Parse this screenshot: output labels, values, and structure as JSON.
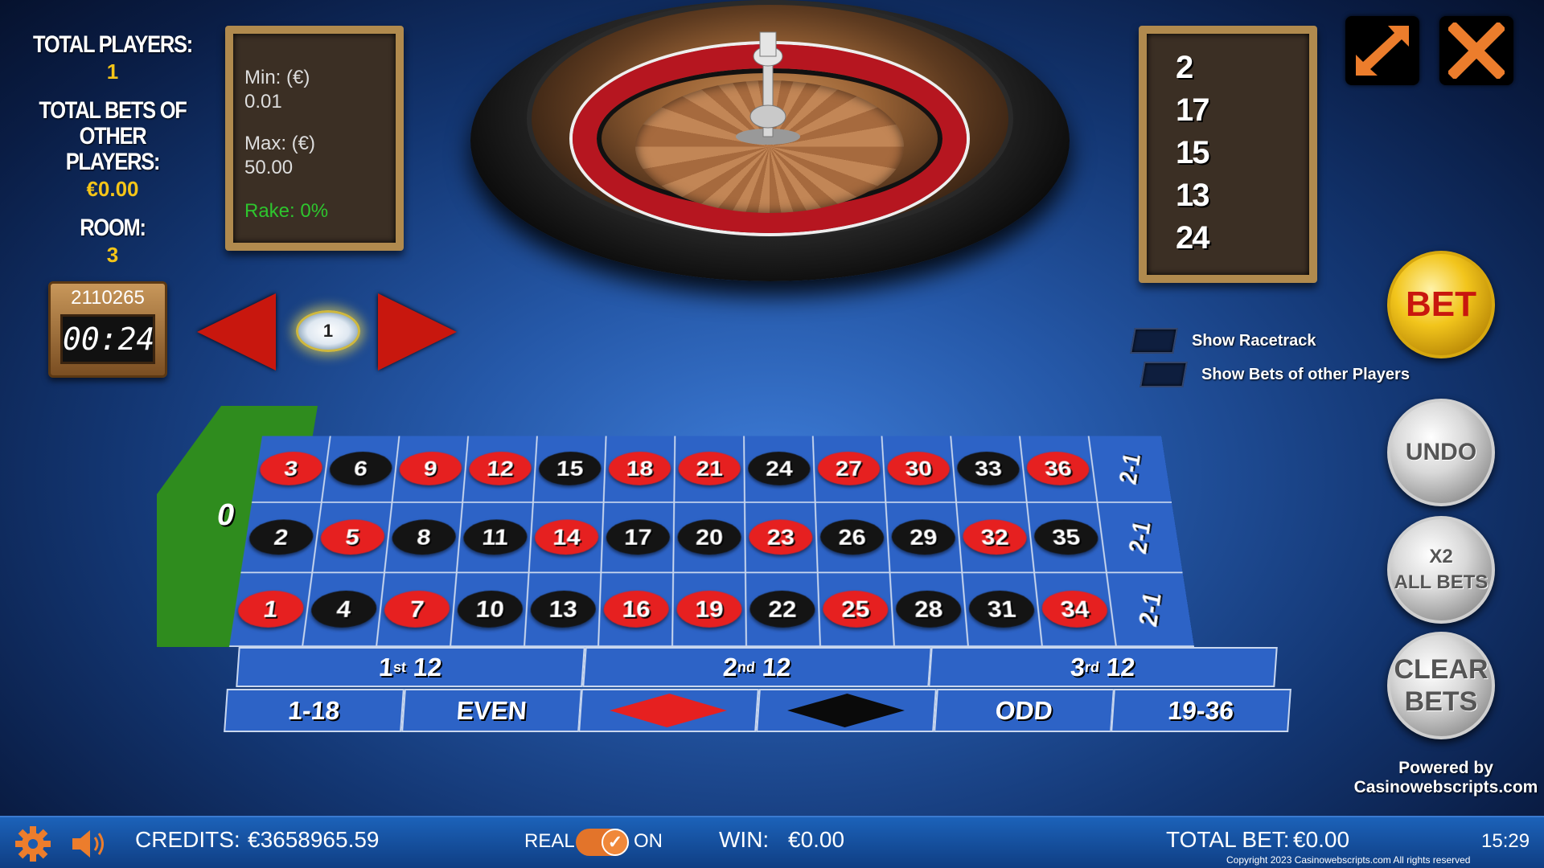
{
  "left_info": {
    "players_label": "TOTAL PLAYERS:",
    "players_value": "1",
    "other_bets_label_1": "TOTAL BETS OF",
    "other_bets_label_2": "OTHER PLAYERS:",
    "other_bets_value": "€0.00",
    "room_label": "ROOM:",
    "room_value": "3"
  },
  "timer": {
    "round_id": "2110265",
    "countdown": "00:24"
  },
  "limits": {
    "min_label": "Min: (€)",
    "min_value": "0.01",
    "max_label": "Max: (€)",
    "max_value": "50.00",
    "rake": "Rake: 0%"
  },
  "history": [
    "2",
    "17",
    "15",
    "13",
    "24"
  ],
  "chip": {
    "value": "1"
  },
  "options": {
    "show_racetrack": "Show Racetrack",
    "show_bets_other": "Show Bets of other Players"
  },
  "buttons": {
    "bet": "BET",
    "undo": "UNDO",
    "x2_line1": "X2",
    "x2_line2": "ALL BETS",
    "clear_line1": "CLEAR",
    "clear_line2": "BETS"
  },
  "powered": {
    "line1": "Powered by",
    "line2": "Casinowebscripts.com"
  },
  "table": {
    "zero": "0",
    "rows": [
      [
        {
          "n": "3",
          "c": "red"
        },
        {
          "n": "6",
          "c": "black"
        },
        {
          "n": "9",
          "c": "red"
        },
        {
          "n": "12",
          "c": "red"
        },
        {
          "n": "15",
          "c": "black"
        },
        {
          "n": "18",
          "c": "red"
        },
        {
          "n": "21",
          "c": "red"
        },
        {
          "n": "24",
          "c": "black"
        },
        {
          "n": "27",
          "c": "red"
        },
        {
          "n": "30",
          "c": "red"
        },
        {
          "n": "33",
          "c": "black"
        },
        {
          "n": "36",
          "c": "red"
        }
      ],
      [
        {
          "n": "2",
          "c": "black"
        },
        {
          "n": "5",
          "c": "red"
        },
        {
          "n": "8",
          "c": "black"
        },
        {
          "n": "11",
          "c": "black"
        },
        {
          "n": "14",
          "c": "red"
        },
        {
          "n": "17",
          "c": "black"
        },
        {
          "n": "20",
          "c": "black"
        },
        {
          "n": "23",
          "c": "red"
        },
        {
          "n": "26",
          "c": "black"
        },
        {
          "n": "29",
          "c": "black"
        },
        {
          "n": "32",
          "c": "red"
        },
        {
          "n": "35",
          "c": "black"
        }
      ],
      [
        {
          "n": "1",
          "c": "red"
        },
        {
          "n": "4",
          "c": "black"
        },
        {
          "n": "7",
          "c": "red"
        },
        {
          "n": "10",
          "c": "black"
        },
        {
          "n": "13",
          "c": "black"
        },
        {
          "n": "16",
          "c": "red"
        },
        {
          "n": "19",
          "c": "red"
        },
        {
          "n": "22",
          "c": "black"
        },
        {
          "n": "25",
          "c": "red"
        },
        {
          "n": "28",
          "c": "black"
        },
        {
          "n": "31",
          "c": "black"
        },
        {
          "n": "34",
          "c": "red"
        }
      ]
    ],
    "column_bet": "2-1",
    "dozens": [
      {
        "base": "1",
        "sup": "st",
        "rest": " 12"
      },
      {
        "base": "2",
        "sup": "nd",
        "rest": " 12"
      },
      {
        "base": "3",
        "sup": "rd",
        "rest": " 12"
      }
    ],
    "outside": {
      "low": "1-18",
      "even": "EVEN",
      "odd": "ODD",
      "high": "19-36"
    }
  },
  "colors": {
    "red": "#e62020",
    "black": "#141414",
    "felt": "#2d63c6",
    "zero_green": "#2f8c1e"
  },
  "bottom_bar": {
    "credits_label": "CREDITS:",
    "credits_value": "€3658965.59",
    "real_label": "REAL",
    "on_label": "ON",
    "win_label": "WIN:",
    "win_value": "€0.00",
    "total_bet_label": "TOTAL BET:",
    "total_bet_value": "€0.00",
    "time": "15:29",
    "copyright": "Copyright 2023 Casinowebscripts.com All rights reserved"
  }
}
